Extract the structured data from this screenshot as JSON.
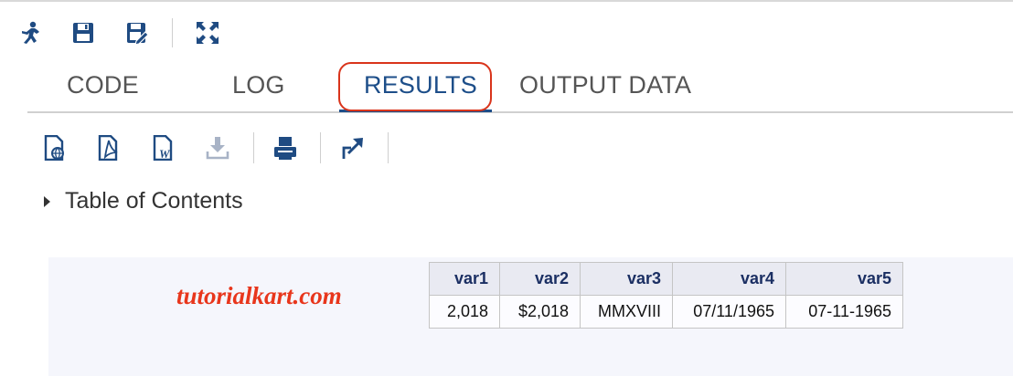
{
  "toolbar": {
    "icons": [
      "run-icon",
      "save-icon",
      "save-as-icon",
      "maximize-icon"
    ]
  },
  "tabs": [
    {
      "label": "CODE",
      "active": false
    },
    {
      "label": "LOG",
      "active": false
    },
    {
      "label": "RESULTS",
      "active": true
    },
    {
      "label": "OUTPUT DATA",
      "active": false
    }
  ],
  "results_toolbar": {
    "icons": [
      "download-html-icon",
      "download-pdf-icon",
      "download-word-icon",
      "download-icon",
      "print-icon",
      "open-new-window-icon"
    ]
  },
  "toc": {
    "label": "Table of Contents"
  },
  "watermark": "tutorialkart.com",
  "table": {
    "columns": [
      "var1",
      "var2",
      "var3",
      "var4",
      "var5"
    ],
    "rows": [
      [
        "2,018",
        "$2,018",
        "MMXVIII",
        "07/11/1965",
        "07-11-1965"
      ]
    ]
  },
  "colors": {
    "accent": "#1d4e89",
    "highlight": "#d9341b",
    "watermark": "#e8361c",
    "table_header_text": "#1b2f63"
  }
}
